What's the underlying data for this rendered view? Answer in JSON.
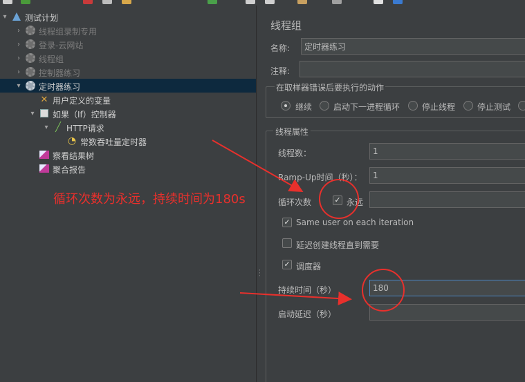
{
  "tree": {
    "items": [
      {
        "label": "测试计划",
        "icon": "test-plan-icon",
        "state": "normal"
      },
      {
        "label": "线程组录制专用",
        "icon": "gear-icon",
        "state": "dim"
      },
      {
        "label": "登录-云网站",
        "icon": "gear-icon",
        "state": "dim"
      },
      {
        "label": "线程组",
        "icon": "gear-icon",
        "state": "dim"
      },
      {
        "label": "控制器练习",
        "icon": "gear-icon",
        "state": "dim"
      },
      {
        "label": "定时器练习",
        "icon": "gear-icon",
        "state": "selected"
      },
      {
        "label": "用户定义的变量",
        "icon": "wrench-icon",
        "state": "normal"
      },
      {
        "label": "如果（If）控制器",
        "icon": "if-controller-icon",
        "state": "normal"
      },
      {
        "label": "HTTP请求",
        "icon": "pipette-icon",
        "state": "normal"
      },
      {
        "label": "常数吞吐量定时器",
        "icon": "timer-icon",
        "state": "normal"
      },
      {
        "label": "察看结果树",
        "icon": "listener-icon",
        "state": "normal"
      },
      {
        "label": "聚合报告",
        "icon": "listener-icon",
        "state": "normal"
      }
    ]
  },
  "panel": {
    "title": "线程组",
    "name_label": "名称:",
    "name_value": "定时器练习",
    "comment_label": "注释:",
    "comment_value": "",
    "error_action": {
      "legend": "在取样器错误后要执行的动作",
      "options": [
        "继续",
        "启动下一进程循环",
        "停止线程",
        "停止测试"
      ],
      "selected": "继续"
    },
    "props": {
      "legend": "线程属性",
      "threads_label": "线程数：",
      "threads_value": "1",
      "rampup_label": "Ramp-Up时间（秒）：",
      "rampup_value": "1",
      "loop_label": "循环次数",
      "forever_label": "永远",
      "forever_checked": true,
      "loop_value": "",
      "same_user_label": "Same user on each iteration",
      "same_user_checked": true,
      "delay_label": "延迟创建线程直到需要",
      "delay_checked": false,
      "scheduler_label": "调度器",
      "scheduler_checked": true,
      "duration_label": "持续时间（秒）",
      "duration_value": "180",
      "startup_label": "启动延迟（秒）",
      "startup_value": ""
    }
  },
  "annotation": {
    "text": "循环次数为永远，持续时间为180s",
    "color": "#e8302c"
  },
  "colors": {
    "background": "#3c3f41",
    "selected_row": "#0d293e",
    "field": "#45494a"
  }
}
